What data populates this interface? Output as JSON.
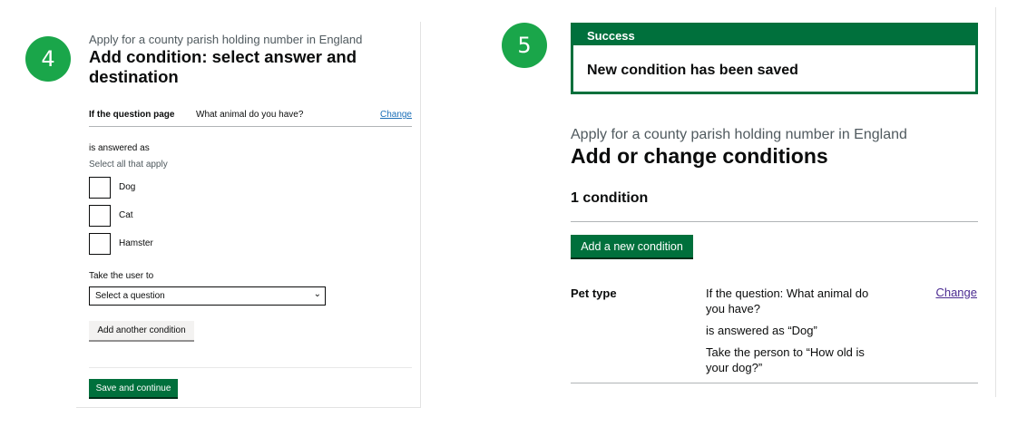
{
  "badges": {
    "step4": "4",
    "step5": "5"
  },
  "panel4": {
    "caption": "Apply for a county parish holding number in England",
    "heading": "Add condition: select answer and destination",
    "summary": {
      "key": "If the question page",
      "value": "What animal do you have?",
      "change_link": "Change"
    },
    "answer_label": "is answered as",
    "answer_hint": "Select all that apply",
    "options": [
      "Dog",
      "Cat",
      "Hamster"
    ],
    "destination_label": "Take the user to",
    "destination_select": {
      "selected": "Select a question"
    },
    "add_another_button": "Add another condition",
    "save_button": "Save and continue"
  },
  "panel5": {
    "banner": {
      "title": "Success",
      "message": "New condition has been saved"
    },
    "caption": "Apply for a county parish holding number in England",
    "heading": "Add or change conditions",
    "count": "1 condition",
    "add_button": "Add a new condition",
    "condition": {
      "name": "Pet type",
      "lines": [
        "If the question: What animal do you have?",
        "is answered as “Dog”",
        "Take the person to “How old is your dog?”"
      ],
      "change_link": "Change"
    }
  },
  "colors": {
    "badge": "#1aa64a",
    "govuk_green": "#00703c",
    "link": "#1d70b8",
    "visited_link": "#4c2c92"
  },
  "icons": {
    "select_chevron": "chevron-down-icon"
  }
}
